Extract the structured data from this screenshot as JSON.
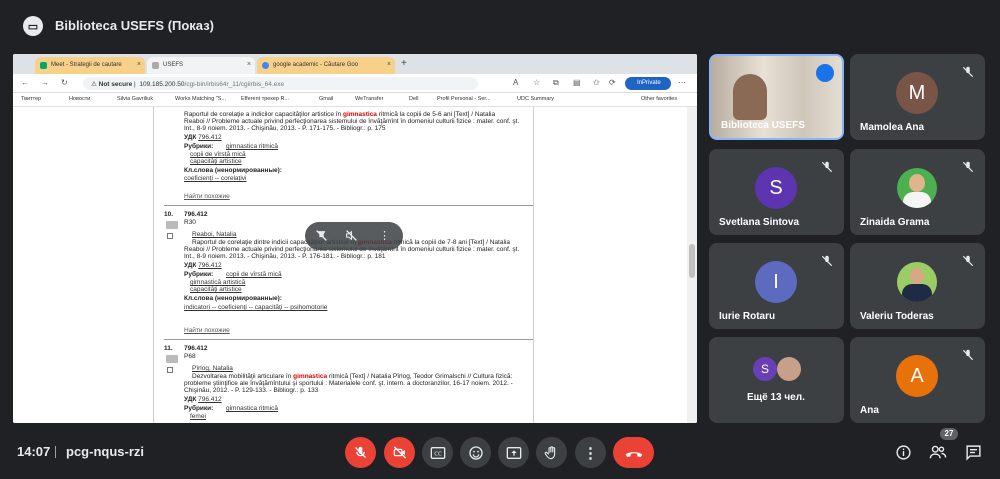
{
  "meeting": {
    "presenter_title": "Biblioteca USEFS (Показ)",
    "time": "14:07",
    "code": "pcg-nqus-rzi",
    "participants_count": "27"
  },
  "browser": {
    "tabs": [
      {
        "label": "Meet - Strategii de cautare"
      },
      {
        "label": "USEFS"
      },
      {
        "label": "google academic - Căutare Goo"
      }
    ],
    "not_secure": "Not secure",
    "url_host": "109.185.200.50",
    "url_path": "/cgi-bin/irbis64r_11/cgiirbis_64.exe",
    "inprivate": "InPrivate",
    "bookmarks": [
      "Твиттер",
      "Новости",
      "Silvia Gavriliuk",
      "Works Matching \"S...",
      "Efferent трекер R...",
      "Gmail",
      "WeTransfer",
      "Dell",
      "Profil Personal - Ser...",
      "UDC Summary",
      "Other favorites"
    ]
  },
  "document": {
    "rec9": {
      "l1": "Raportul de corelaţie a indicilor capacităţilor artistice în ",
      "hl": "gimnastica",
      "l1b": " ritmică la copiii de 5-6 ani [Text] / Natalia",
      "l2": "Reaboi // Probleme actuale privind perfecţionarea sistemului de învăţămînt în domeniul culturii fizice : mater. conf. şt.",
      "l3": "Int., 8-9 noiem. 2013. - Chişinău, 2013. - P. 171-175. - Bibliogr.: p. 175",
      "udc_label": "УДК",
      "udc": "796.412",
      "rubrics_label": "Рубрики:",
      "r1": "gimnastica ritmică",
      "r2": "copii de vîrstă mică",
      "r3": "capacităţi artistice",
      "kw_label": "Кл.слова (ненормированные):",
      "kw": "coeficienţi -- corelaţivi",
      "similar": "Найти похожие"
    },
    "rec10": {
      "num": "10.",
      "udc_head": "796.412",
      "code": "R30",
      "author": "Reaboi, Natalia",
      "l1": "Raportul de corelaţie dintre indicii capacităţilor artistice în ",
      "hl": "gimnastica",
      "l1b": " ritmică la copiii de 7-8 ani [Text] / Natalia",
      "l2": "Reaboi // Probleme actuale privind perfecţionarea sistemului de învăţămînt în domeniul culturii fizice : mater. conf. şt.",
      "l3": "Int., 8-9 noiem. 2013. - Chişinău, 2013. - P. 176-181. - Bibliogr.: p. 181",
      "udc_label": "УДК",
      "udc": "796.412",
      "rubrics_label": "Рубрики:",
      "r1": "copii de vîrstă mică",
      "r2": "gimnastică artistică",
      "r3": "capacităţi artistice",
      "kw_label": "Кл.слова (ненормированные):",
      "kw": "indicatori -- coeficienţi -- capacităţi -- psihomotorie",
      "similar": "Найти похожие"
    },
    "rec11": {
      "num": "11.",
      "udc_head": "796.412",
      "code": "P68",
      "author": "Pîrlog, Natalia",
      "l1": "Dezvoltarea mobilităţii articulare în ",
      "hl": "gimnastica",
      "l1b": " ritmică [Text] / Natalia Pîrlog, Teodor Grimalschi // Cultura fizică:",
      "l2": "probleme ştiinţifice ale învăţămîntului şi sportului : Materialele conf. şt. intern. a doctoranzilor, 16-17 noiem. 2012. -",
      "l3": "Chişinău, 2012. - P. 129-133. - Bibliogr.: p. 133",
      "udc_label": "УДК",
      "udc": "796.412",
      "rubrics_label": "Рубрики:",
      "r1": "gimnastica ritmică",
      "r2": "femei"
    }
  },
  "participants": [
    {
      "name": "Biblioteca USEFS",
      "type": "video"
    },
    {
      "name": "Mamolea Ana",
      "initial": "M",
      "color": "#795548"
    },
    {
      "name": "Svetlana Sintova",
      "initial": "S",
      "color": "#5e35b1"
    },
    {
      "name": "Zinaida Grama",
      "type": "photo"
    },
    {
      "name": "Iurie Rotaru",
      "initial": "I",
      "color": "#5c6bc0"
    },
    {
      "name": "Valeriu Toderas",
      "type": "photo"
    },
    {
      "name": "Ещё 13 чел.",
      "initial": "S",
      "color": "#6a3fb5"
    },
    {
      "name": "Ana",
      "initial": "A",
      "color": "#e8710a"
    }
  ],
  "colors": {
    "background": "#202124",
    "tile": "#3c4043",
    "danger": "#ea4335",
    "accent": "#8ab4f8"
  }
}
